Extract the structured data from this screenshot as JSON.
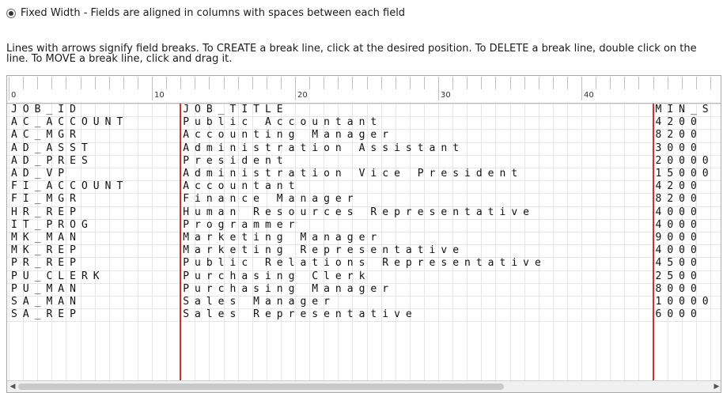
{
  "format_option": {
    "label": "Fixed Width - Fields are aligned in columns with spaces between each field",
    "selected": true
  },
  "instructions": "Lines with arrows signify field breaks. To CREATE a break line, click at the desired position. To DELETE a break line, double click on the line. To MOVE a break line, click and drag it.",
  "ruler": {
    "labels": [
      "0",
      "10",
      "20",
      "30",
      "40"
    ]
  },
  "rows": [
    {
      "col1": "JOB_ID",
      "col2": "JOB_TITLE",
      "col3": "MIN_S"
    },
    {
      "col1": "AC_ACCOUNT",
      "col2": "Public Accountant",
      "col3": "4200"
    },
    {
      "col1": "AC_MGR",
      "col2": "Accounting Manager",
      "col3": "8200"
    },
    {
      "col1": "AD_ASST",
      "col2": "Administration Assistant",
      "col3": "3000"
    },
    {
      "col1": "AD_PRES",
      "col2": "President",
      "col3": "20000"
    },
    {
      "col1": "AD_VP",
      "col2": "Administration Vice President",
      "col3": "15000"
    },
    {
      "col1": "FI_ACCOUNT",
      "col2": "Accountant",
      "col3": "4200"
    },
    {
      "col1": "FI_MGR",
      "col2": "Finance Manager",
      "col3": "8200"
    },
    {
      "col1": "HR_REP",
      "col2": "Human Resources Representative",
      "col3": "4000"
    },
    {
      "col1": "IT_PROG",
      "col2": "Programmer",
      "col3": "4000"
    },
    {
      "col1": "MK_MAN",
      "col2": "Marketing Manager",
      "col3": "9000"
    },
    {
      "col1": "MK_REP",
      "col2": "Marketing Representative",
      "col3": "4000"
    },
    {
      "col1": "PR_REP",
      "col2": "Public Relations Representative",
      "col3": "4500"
    },
    {
      "col1": "PU_CLERK",
      "col2": "Purchasing Clerk",
      "col3": "2500"
    },
    {
      "col1": "PU_MAN",
      "col2": "Purchasing Manager",
      "col3": "8000"
    },
    {
      "col1": "SA_MAN",
      "col2": "Sales Manager",
      "col3": "10000"
    },
    {
      "col1": "SA_REP",
      "col2": "Sales Representative",
      "col3": "6000"
    }
  ],
  "colors": {
    "break_line": "#d32f2f",
    "grid": "#e6e6e6"
  },
  "icons": {
    "scroll_left": "triangle-left-icon",
    "scroll_right": "triangle-right-icon"
  }
}
